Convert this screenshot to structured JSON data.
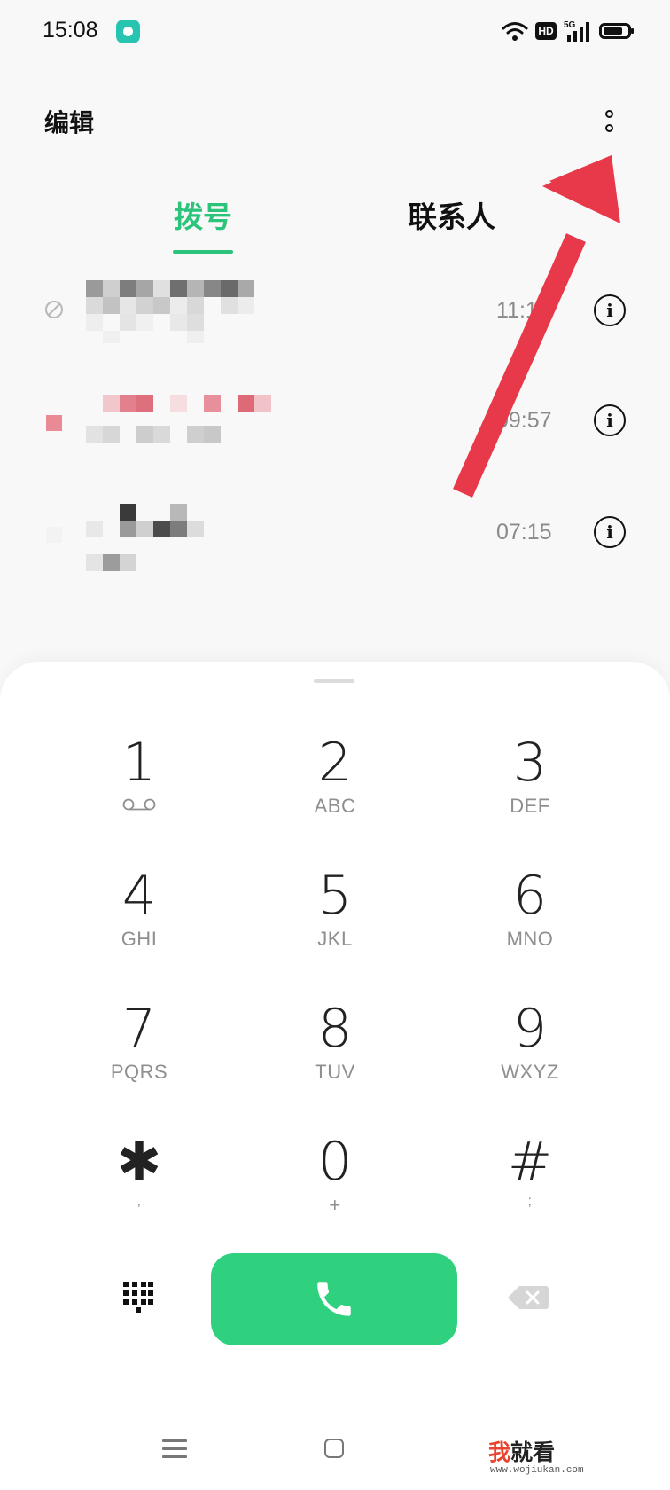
{
  "status_bar": {
    "time": "15:08",
    "hd_label": "HD",
    "network_label": "5G"
  },
  "header": {
    "edit_label": "编辑"
  },
  "tabs": [
    {
      "label": "拨号",
      "active": true
    },
    {
      "label": "联系人",
      "active": false
    }
  ],
  "call_log": [
    {
      "time": "11:11",
      "number_visible": "15"
    },
    {
      "time": "09:57"
    },
    {
      "time": "07:15"
    }
  ],
  "dialpad": {
    "keys": [
      {
        "digit": "1",
        "letters": ""
      },
      {
        "digit": "2",
        "letters": "ABC"
      },
      {
        "digit": "3",
        "letters": "DEF"
      },
      {
        "digit": "4",
        "letters": "GHI"
      },
      {
        "digit": "5",
        "letters": "JKL"
      },
      {
        "digit": "6",
        "letters": "MNO"
      },
      {
        "digit": "7",
        "letters": "PQRS"
      },
      {
        "digit": "8",
        "letters": "TUV"
      },
      {
        "digit": "9",
        "letters": "WXYZ"
      },
      {
        "digit": "✱",
        "letters": ","
      },
      {
        "digit": "0",
        "letters": "+"
      },
      {
        "digit": "#",
        "letters": ";"
      }
    ]
  },
  "icons": {
    "voicemail": "voicemail-icon",
    "keypad": "keypad-icon",
    "call": "phone-icon",
    "delete": "backspace-icon",
    "more": "more-icon"
  },
  "colors": {
    "accent": "#2bc47a",
    "call_button": "#2fd17f",
    "annotation_arrow": "#e8394a"
  },
  "watermark": {
    "red_char": "我",
    "text": "就看",
    "url": "www.wojiukan.com"
  }
}
